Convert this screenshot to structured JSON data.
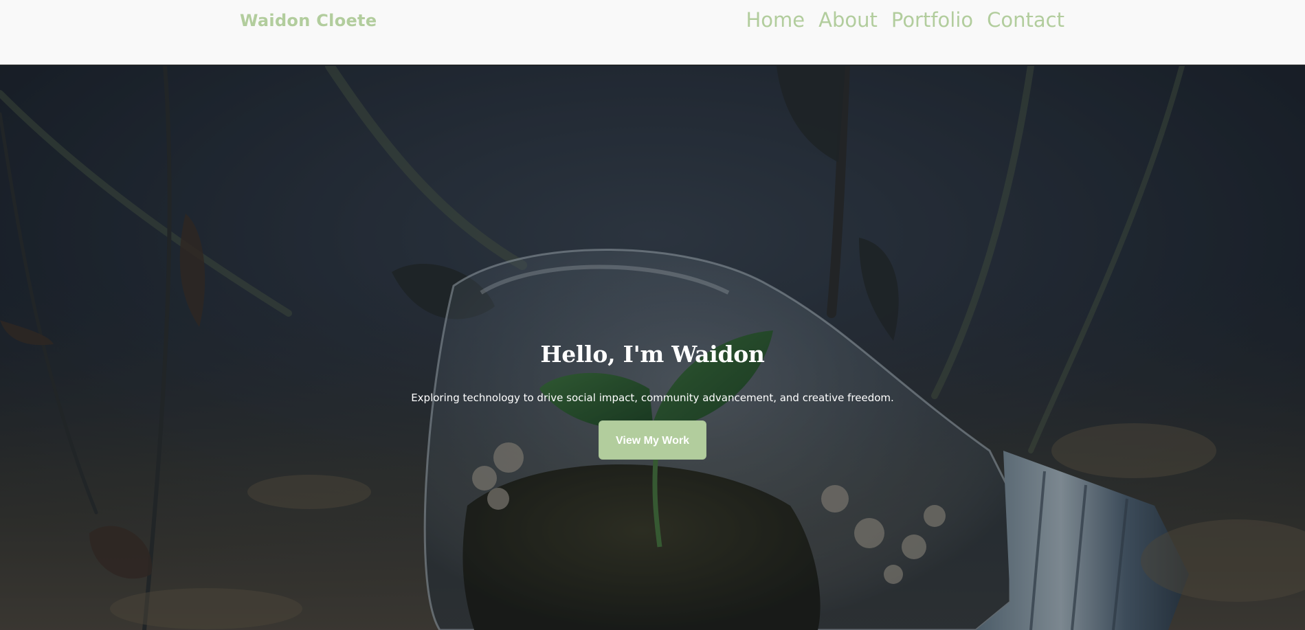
{
  "header": {
    "brand": "Waidon Cloete",
    "nav": [
      {
        "label": "Home"
      },
      {
        "label": "About"
      },
      {
        "label": "Portfolio"
      },
      {
        "label": "Contact"
      }
    ]
  },
  "hero": {
    "title": "Hello, I'm Waidon",
    "subtitle": "Exploring technology to drive social impact, community advancement, and creative freedom.",
    "cta_label": "View My Work"
  },
  "colors": {
    "accent": "#b2cd9d",
    "nav_background": "#f9f9f9",
    "hero_text": "#ffffff"
  }
}
